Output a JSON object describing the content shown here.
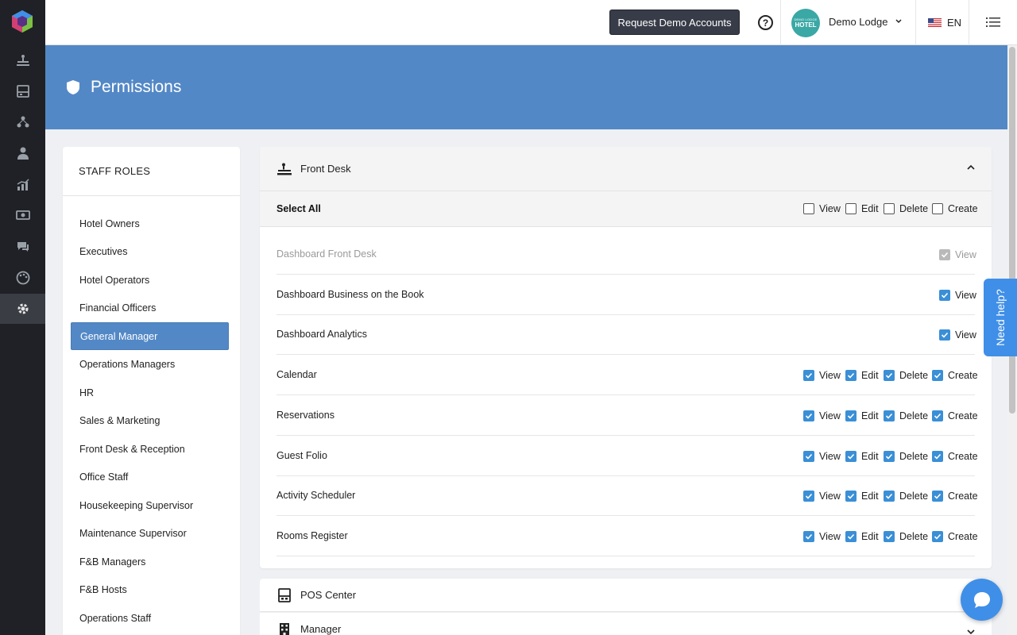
{
  "topbar": {
    "demo_button": "Request Demo Accounts",
    "help_symbol": "?",
    "hotel_avatar_small": "DEMO LODGE",
    "hotel_avatar_large": "HOTEL",
    "hotel_name": "Demo Lodge",
    "language": "EN"
  },
  "rail": {
    "icons": [
      "front-desk-icon",
      "pos-icon",
      "manager-icon",
      "user-icon",
      "analytics-icon",
      "money-icon",
      "chat-icon",
      "palette-icon",
      "settings-icon"
    ],
    "active_index": 8
  },
  "page": {
    "title": "Permissions"
  },
  "roles": {
    "heading": "STAFF ROLES",
    "items": [
      "Hotel Owners",
      "Executives",
      "Hotel Operators",
      "Financial Officers",
      "General Manager",
      "Operations Managers",
      "HR",
      "Sales & Marketing",
      "Front Desk & Reception",
      "Office Staff",
      "Housekeeping Supervisor",
      "Maintenance Supervisor",
      "F&B Managers",
      "F&B Hosts",
      "Operations Staff"
    ],
    "active_index": 4
  },
  "section": {
    "title": "Front Desk",
    "select_all": "Select All",
    "labels": {
      "view": "View",
      "edit": "Edit",
      "delete": "Delete",
      "create": "Create"
    },
    "select_all_state": {
      "view": false,
      "edit": false,
      "delete": false,
      "create": false
    },
    "rows": [
      {
        "name": "Dashboard Front Desk",
        "disabled": true,
        "perms": [
          "view"
        ],
        "checked": [
          true
        ]
      },
      {
        "name": "Dashboard Business on the Book",
        "disabled": false,
        "perms": [
          "view"
        ],
        "checked": [
          true
        ]
      },
      {
        "name": "Dashboard Analytics",
        "disabled": false,
        "perms": [
          "view"
        ],
        "checked": [
          true
        ]
      },
      {
        "name": "Calendar",
        "disabled": false,
        "perms": [
          "view",
          "edit",
          "delete",
          "create"
        ],
        "checked": [
          true,
          true,
          true,
          true
        ]
      },
      {
        "name": "Reservations",
        "disabled": false,
        "perms": [
          "view",
          "edit",
          "delete",
          "create"
        ],
        "checked": [
          true,
          true,
          true,
          true
        ]
      },
      {
        "name": "Guest Folio",
        "disabled": false,
        "perms": [
          "view",
          "edit",
          "delete",
          "create"
        ],
        "checked": [
          true,
          true,
          true,
          true
        ]
      },
      {
        "name": "Activity Scheduler",
        "disabled": false,
        "perms": [
          "view",
          "edit",
          "delete",
          "create"
        ],
        "checked": [
          true,
          true,
          true,
          true
        ]
      },
      {
        "name": "Rooms Register",
        "disabled": false,
        "perms": [
          "view",
          "edit",
          "delete",
          "create"
        ],
        "checked": [
          true,
          true,
          true,
          true
        ]
      }
    ]
  },
  "collapsed_sections": [
    {
      "title": "POS Center",
      "icon": "pos-icon"
    },
    {
      "title": "Manager",
      "icon": "building-icon"
    }
  ],
  "need_help": "Need help?",
  "colors": {
    "accent": "#5388c6",
    "checkbox": "#3a8fd6",
    "rail": "#1f2126",
    "help_tab": "#3f8fe8"
  }
}
